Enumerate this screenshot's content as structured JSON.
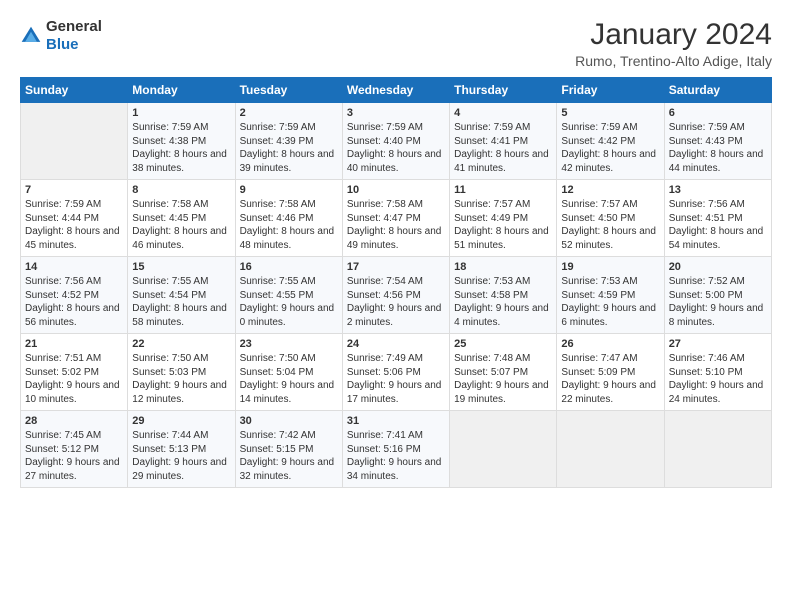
{
  "logo": {
    "general": "General",
    "blue": "Blue"
  },
  "title": "January 2024",
  "subtitle": "Rumo, Trentino-Alto Adige, Italy",
  "days_of_week": [
    "Sunday",
    "Monday",
    "Tuesday",
    "Wednesday",
    "Thursday",
    "Friday",
    "Saturday"
  ],
  "weeks": [
    [
      {
        "day": "",
        "empty": true
      },
      {
        "day": "1",
        "sunrise": "7:59 AM",
        "sunset": "4:38 PM",
        "daylight": "8 hours and 38 minutes."
      },
      {
        "day": "2",
        "sunrise": "7:59 AM",
        "sunset": "4:39 PM",
        "daylight": "8 hours and 39 minutes."
      },
      {
        "day": "3",
        "sunrise": "7:59 AM",
        "sunset": "4:40 PM",
        "daylight": "8 hours and 40 minutes."
      },
      {
        "day": "4",
        "sunrise": "7:59 AM",
        "sunset": "4:41 PM",
        "daylight": "8 hours and 41 minutes."
      },
      {
        "day": "5",
        "sunrise": "7:59 AM",
        "sunset": "4:42 PM",
        "daylight": "8 hours and 42 minutes."
      },
      {
        "day": "6",
        "sunrise": "7:59 AM",
        "sunset": "4:43 PM",
        "daylight": "8 hours and 44 minutes."
      }
    ],
    [
      {
        "day": "7",
        "sunrise": "7:59 AM",
        "sunset": "4:44 PM",
        "daylight": "8 hours and 45 minutes."
      },
      {
        "day": "8",
        "sunrise": "7:58 AM",
        "sunset": "4:45 PM",
        "daylight": "8 hours and 46 minutes."
      },
      {
        "day": "9",
        "sunrise": "7:58 AM",
        "sunset": "4:46 PM",
        "daylight": "8 hours and 48 minutes."
      },
      {
        "day": "10",
        "sunrise": "7:58 AM",
        "sunset": "4:47 PM",
        "daylight": "8 hours and 49 minutes."
      },
      {
        "day": "11",
        "sunrise": "7:57 AM",
        "sunset": "4:49 PM",
        "daylight": "8 hours and 51 minutes."
      },
      {
        "day": "12",
        "sunrise": "7:57 AM",
        "sunset": "4:50 PM",
        "daylight": "8 hours and 52 minutes."
      },
      {
        "day": "13",
        "sunrise": "7:56 AM",
        "sunset": "4:51 PM",
        "daylight": "8 hours and 54 minutes."
      }
    ],
    [
      {
        "day": "14",
        "sunrise": "7:56 AM",
        "sunset": "4:52 PM",
        "daylight": "8 hours and 56 minutes."
      },
      {
        "day": "15",
        "sunrise": "7:55 AM",
        "sunset": "4:54 PM",
        "daylight": "8 hours and 58 minutes."
      },
      {
        "day": "16",
        "sunrise": "7:55 AM",
        "sunset": "4:55 PM",
        "daylight": "9 hours and 0 minutes."
      },
      {
        "day": "17",
        "sunrise": "7:54 AM",
        "sunset": "4:56 PM",
        "daylight": "9 hours and 2 minutes."
      },
      {
        "day": "18",
        "sunrise": "7:53 AM",
        "sunset": "4:58 PM",
        "daylight": "9 hours and 4 minutes."
      },
      {
        "day": "19",
        "sunrise": "7:53 AM",
        "sunset": "4:59 PM",
        "daylight": "9 hours and 6 minutes."
      },
      {
        "day": "20",
        "sunrise": "7:52 AM",
        "sunset": "5:00 PM",
        "daylight": "9 hours and 8 minutes."
      }
    ],
    [
      {
        "day": "21",
        "sunrise": "7:51 AM",
        "sunset": "5:02 PM",
        "daylight": "9 hours and 10 minutes."
      },
      {
        "day": "22",
        "sunrise": "7:50 AM",
        "sunset": "5:03 PM",
        "daylight": "9 hours and 12 minutes."
      },
      {
        "day": "23",
        "sunrise": "7:50 AM",
        "sunset": "5:04 PM",
        "daylight": "9 hours and 14 minutes."
      },
      {
        "day": "24",
        "sunrise": "7:49 AM",
        "sunset": "5:06 PM",
        "daylight": "9 hours and 17 minutes."
      },
      {
        "day": "25",
        "sunrise": "7:48 AM",
        "sunset": "5:07 PM",
        "daylight": "9 hours and 19 minutes."
      },
      {
        "day": "26",
        "sunrise": "7:47 AM",
        "sunset": "5:09 PM",
        "daylight": "9 hours and 22 minutes."
      },
      {
        "day": "27",
        "sunrise": "7:46 AM",
        "sunset": "5:10 PM",
        "daylight": "9 hours and 24 minutes."
      }
    ],
    [
      {
        "day": "28",
        "sunrise": "7:45 AM",
        "sunset": "5:12 PM",
        "daylight": "9 hours and 27 minutes."
      },
      {
        "day": "29",
        "sunrise": "7:44 AM",
        "sunset": "5:13 PM",
        "daylight": "9 hours and 29 minutes."
      },
      {
        "day": "30",
        "sunrise": "7:42 AM",
        "sunset": "5:15 PM",
        "daylight": "9 hours and 32 minutes."
      },
      {
        "day": "31",
        "sunrise": "7:41 AM",
        "sunset": "5:16 PM",
        "daylight": "9 hours and 34 minutes."
      },
      {
        "day": "",
        "empty": true
      },
      {
        "day": "",
        "empty": true
      },
      {
        "day": "",
        "empty": true
      }
    ]
  ]
}
